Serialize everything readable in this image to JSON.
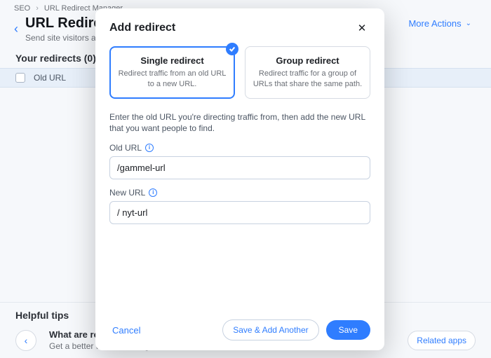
{
  "breadcrumb": {
    "parent": "SEO",
    "current": "URL Redirect Manager"
  },
  "header": {
    "title": "URL Redirect Manager",
    "subtitle": "Send site visitors and search engines to a new URL.",
    "more_actions": "More Actions"
  },
  "redirects": {
    "section_label": "Your redirects (0)",
    "col_old_url": "Old URL"
  },
  "tips": {
    "section_label": "Helpful tips",
    "item_title": "What are redirects?",
    "item_subtitle": "Get a better understanding of how redirects work.",
    "related_button": "Related apps"
  },
  "modal": {
    "title": "Add redirect",
    "types": {
      "single": {
        "title": "Single redirect",
        "desc": "Redirect traffic from an old URL to a new URL."
      },
      "group": {
        "title": "Group redirect",
        "desc": "Redirect traffic for a group of URLs that share the same path."
      }
    },
    "helper": "Enter the old URL you're directing traffic from, then add the new URL that you want people to find.",
    "old_url": {
      "label": "Old URL",
      "value": "/gammel-url"
    },
    "new_url": {
      "label": "New URL",
      "value": "/ nyt-url"
    },
    "buttons": {
      "cancel": "Cancel",
      "save_another": "Save & Add Another",
      "save": "Save"
    }
  }
}
